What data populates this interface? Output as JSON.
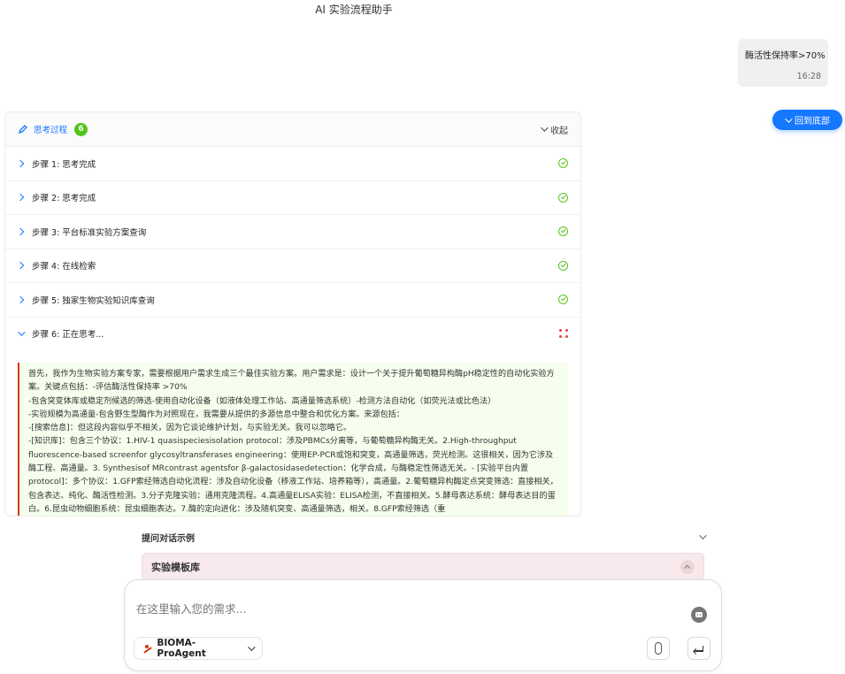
{
  "app": {
    "title": "AI 实验流程助手"
  },
  "user_message": {
    "text": "酶活性保持率>70%",
    "time": "16:28"
  },
  "scroll_button": {
    "label": "回到底部"
  },
  "thinking": {
    "title": "思考过程",
    "count": "6",
    "collapse_label": "收起",
    "steps": [
      {
        "label": "步骤 1: 思考完成",
        "status": "done"
      },
      {
        "label": "步骤 2: 思考完成",
        "status": "done"
      },
      {
        "label": "步骤 3: 平台标准实验方案查询",
        "status": "done"
      },
      {
        "label": "步骤 4: 在线检索",
        "status": "done"
      },
      {
        "label": "步骤 5: 独家生物实验知识库查询",
        "status": "done"
      },
      {
        "label": "步骤 6: 正在思考...",
        "status": "loading"
      }
    ],
    "content_lines": [
      "首先，我作为生物实验方案专家，需要根据用户需求生成三个最佳实验方案。用户需求是：设计一个关于提升葡萄糖异构酶pH稳定性的自动化实验方案。关键点包括：-评估酶活性保持率 >70%",
      "-包含突变体库或稳定剂候选的筛选-使用自动化设备（如液体处理工作站、高通量筛选系统）-检测方法自动化（如荧光法或比色法）",
      "-实验规模为高通量-包含野生型酶作为对照现在，我需要从提供的多源信息中整合和优化方案。来源包括：",
      "-[搜索信息]：但这段内容似乎不相关，因为它谈论维护计划，与实验无关。我可以忽略它。",
      "-[知识库]：包含三个协议：1.HIV-1 quasispeciesisolation protocol：涉及PBMCs分离等，与葡萄糖异构酶无关。2.High-throughput fluorescence-based screenfor glycosyltransferases engineering：使用EP-PCR或饱和突变，高通量筛选，荧光检测。这很相关，因为它涉及酶工程、高通量。3. Synthesisof MRcontrast agentsfor β-galactosidasedetection：化学合成，与酶稳定性筛选无关。- [实验平台内置protocol]：多个协议：1.GFP索经筛选自动化流程：涉及自动化设备（移液工作站、培养箱等），高通量。2.葡萄糖异构酶定点突变筛选：直接相关，包含表达、纯化、酶活性检测。3.分子克隆实验：通用克隆流程。4.高通量ELISA实验：ELISA检测，不直接相关。5.酵母表达系统：酵母表达目的蛋白。6.昆虫动物细胞系统：昆虫细胞表达。7.酶的定向进化：涉及随机突变、高通量筛选，相关。8.GFP索经筛选（重"
    ]
  },
  "examples": {
    "label": "提问对话示例"
  },
  "template_library": {
    "label": "实验模板库"
  },
  "input": {
    "placeholder": "在这里输入您的需求..."
  },
  "model_selector": {
    "label": "BIOMA-ProAgent"
  },
  "colors": {
    "primary": "#1677ff",
    "success": "#52c41a",
    "accent": "#d4380d"
  }
}
